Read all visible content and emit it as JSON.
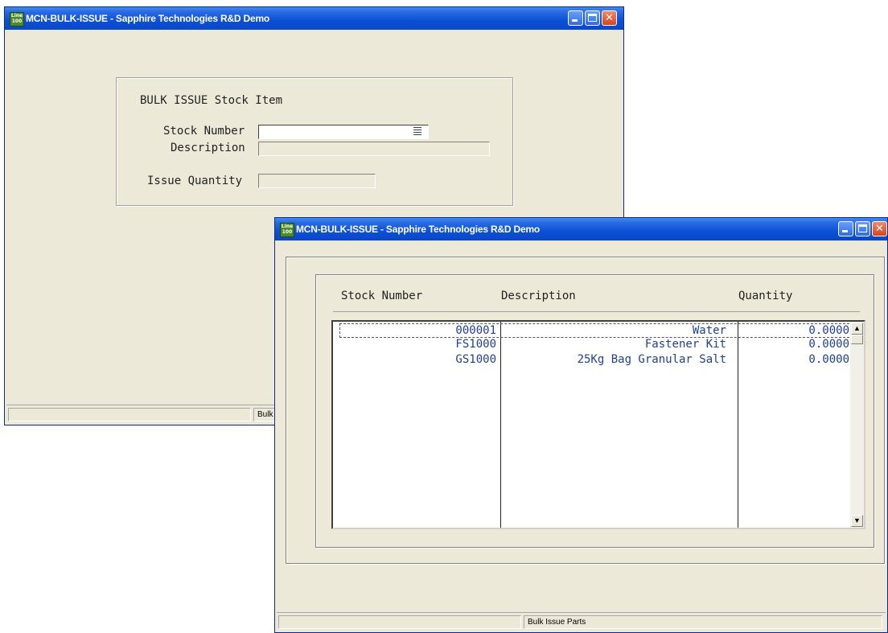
{
  "window_back": {
    "title": "MCN-BULK-ISSUE - Sapphire Technologies R&D Demo",
    "app_icon_text": "Line 100",
    "form": {
      "heading": "BULK ISSUE Stock Item",
      "stock_number_label": "Stock Number",
      "stock_number_value": "",
      "description_label": "Description",
      "description_value": "",
      "issue_quantity_label": "Issue Quantity",
      "issue_quantity_value": ""
    },
    "status": {
      "pane1": "",
      "pane2": "Bulk"
    }
  },
  "window_front": {
    "title": "MCN-BULK-ISSUE - Sapphire Technologies R&D Demo",
    "app_icon_text": "Line 100",
    "grid": {
      "headers": {
        "stock_number": "Stock Number",
        "description": "Description",
        "quantity": "Quantity"
      },
      "rows": [
        {
          "stock_number": "000001",
          "description": "Water",
          "quantity": "0.0000"
        },
        {
          "stock_number": "FS1000",
          "description": "Fastener Kit",
          "quantity": "0.0000"
        },
        {
          "stock_number": "GS1000",
          "description": "25Kg Bag Granular Salt",
          "quantity": "0.0000"
        }
      ],
      "selected_row": 0
    },
    "status": {
      "pane1": "",
      "pane2": "Bulk Issue Parts"
    }
  },
  "colors": {
    "titlebar": "#0a50d8",
    "window_bg": "#ece9d8",
    "grid_text": "#1f3f9e",
    "close_button": "#d9431e"
  },
  "icons": {
    "app": "line100-app-icon",
    "minimize": "minimize-icon",
    "maximize": "maximize-icon",
    "close": "close-icon",
    "lookup": "lookup-list-icon",
    "scroll_up": "scroll-up-arrow-icon",
    "scroll_down": "scroll-down-arrow-icon"
  }
}
